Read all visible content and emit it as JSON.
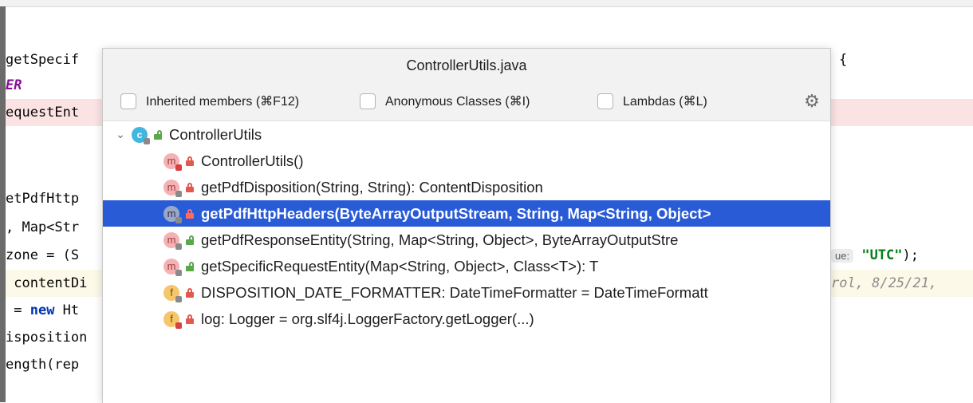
{
  "editor": {
    "lines": [
      {
        "text": "getSpecif",
        "extra": "{"
      },
      {
        "text": "ER"
      },
      {
        "text": "equestEnt"
      },
      {
        "text": ""
      },
      {
        "text": "etPdfHttp"
      },
      {
        "text": ", Map<Str"
      },
      {
        "text": "zone = (S",
        "hint_label": "ue:",
        "string": "\"UTC\"",
        "tail": ");"
      },
      {
        "text": " contentDi",
        "comment": "rol, 8/25/21,"
      },
      {
        "text": " = ",
        "keyword": "new",
        "after": " Ht"
      },
      {
        "text": "isposition"
      },
      {
        "text": "ength(rep"
      }
    ]
  },
  "popup": {
    "title": "ControllerUtils.java",
    "filters": [
      {
        "label": "Inherited members (⌘F12)",
        "checked": false
      },
      {
        "label": "Anonymous Classes (⌘I)",
        "checked": false
      },
      {
        "label": "Lambdas (⌘L)",
        "checked": false
      }
    ],
    "settings_icon": "gear-icon",
    "tree": {
      "root": {
        "label": "ControllerUtils",
        "icon": "class-icon",
        "expanded": true
      },
      "members": [
        {
          "label": "ControllerUtils()",
          "kind": "method",
          "visibility": "private"
        },
        {
          "label": "getPdfDisposition(String, String): ContentDisposition",
          "kind": "method",
          "visibility": "private"
        },
        {
          "label": "getPdfHttpHeaders(ByteArrayOutputStream, String, Map<String, Object>",
          "kind": "method",
          "visibility": "private",
          "selected": true
        },
        {
          "label": "getPdfResponseEntity(String, Map<String, Object>, ByteArrayOutputStre",
          "kind": "method",
          "visibility": "public"
        },
        {
          "label": "getSpecificRequestEntity(Map<String, Object>, Class<T>): T",
          "kind": "method",
          "visibility": "public"
        },
        {
          "label": "DISPOSITION_DATE_FORMATTER: DateTimeFormatter = DateTimeFormatt",
          "kind": "field",
          "visibility": "private"
        },
        {
          "label": "log: Logger = org.slf4j.LoggerFactory.getLogger(...)",
          "kind": "field",
          "visibility": "private"
        }
      ]
    }
  },
  "colors": {
    "selection": "#2a5bd7",
    "error_line": "#fbe3e3",
    "class_icon": "#40b6e0",
    "method_icon": "#f5b1b3",
    "field_icon": "#f6c66a"
  }
}
